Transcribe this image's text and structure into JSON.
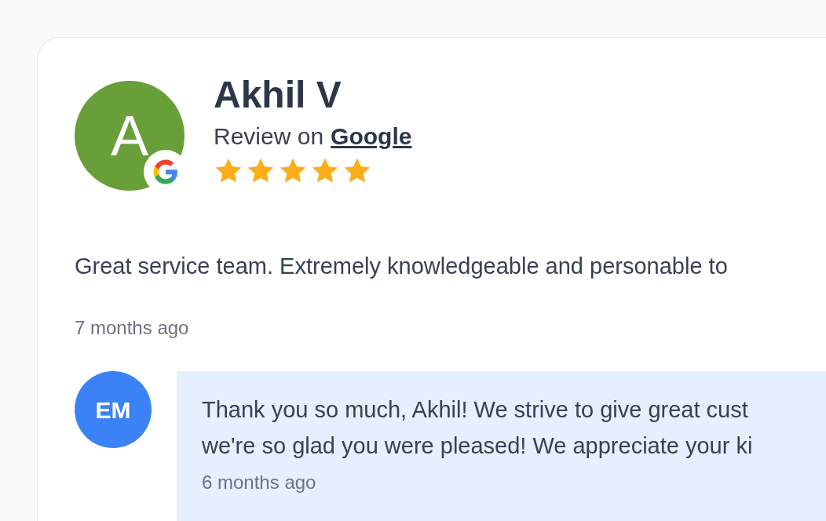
{
  "review": {
    "avatar_letter": "A",
    "name": "Akhil V",
    "source_label": "Review on",
    "source_link": "Google",
    "stars": 5,
    "text": "Great service team. Extremely knowledgeable and personable to",
    "time": "7 months ago"
  },
  "reply": {
    "initials": "EM",
    "lines": [
      "Thank you so much, Akhil! We strive to give great cust",
      "we're so glad you were pleased! We appreciate your ki"
    ],
    "time": "6 months ago"
  }
}
